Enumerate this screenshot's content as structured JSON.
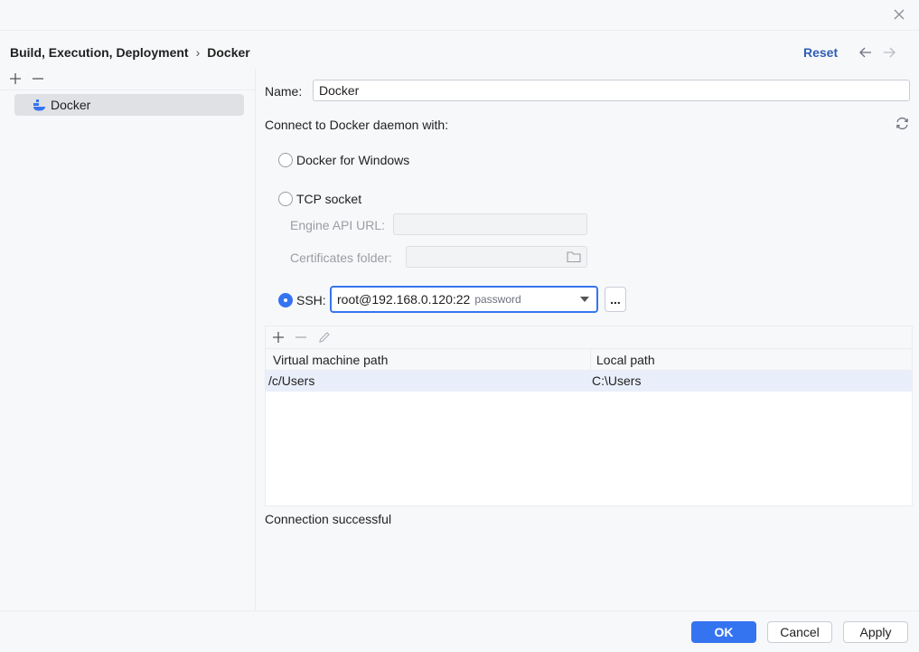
{
  "header": {
    "breadcrumb": [
      "Build, Execution, Deployment",
      "Docker"
    ],
    "breadcrumb_separator": "›",
    "reset_label": "Reset"
  },
  "sidebar": {
    "items": [
      {
        "label": "Docker",
        "icon": "docker-icon",
        "selected": true
      }
    ]
  },
  "form": {
    "name_label": "Name:",
    "name_value": "Docker",
    "connect_label": "Connect to Docker daemon with:",
    "options": {
      "docker_for_windows": {
        "label": "Docker for Windows",
        "checked": false
      },
      "tcp_socket": {
        "label": "TCP socket",
        "checked": false
      },
      "ssh": {
        "label": "SSH:",
        "checked": true
      }
    },
    "engine_api_url_label": "Engine API URL:",
    "engine_api_url_value": "",
    "certificates_folder_label": "Certificates folder:",
    "certificates_folder_value": "",
    "ssh_value": "root@192.168.0.120:22",
    "ssh_hint": "password",
    "browse_label": "..."
  },
  "path_mappings": {
    "columns": [
      "Virtual machine path",
      "Local path"
    ],
    "rows": [
      {
        "vm_path": "/c/Users",
        "local_path": "C:\\Users"
      }
    ]
  },
  "status_text": "Connection successful",
  "footer": {
    "ok_label": "OK",
    "cancel_label": "Cancel",
    "apply_label": "Apply"
  },
  "colors": {
    "accent": "#3574f0",
    "link": "#2f5fb3",
    "selection": "#e9effa"
  }
}
